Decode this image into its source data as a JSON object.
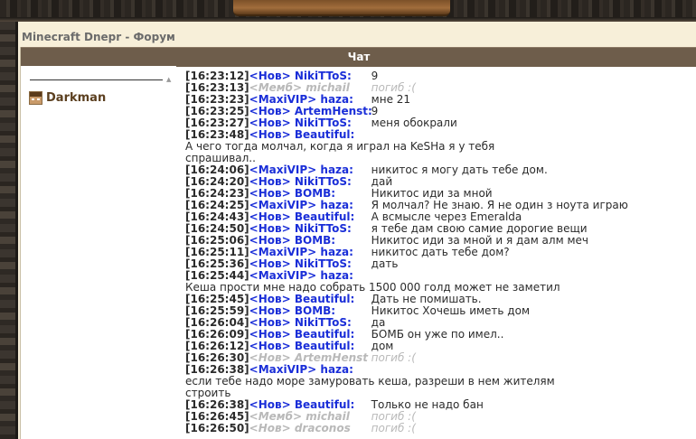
{
  "forum_title": "Minecraft Dnepr - Форум",
  "chat": {
    "header": "Чат",
    "users": [
      {
        "name": "Darkman"
      }
    ],
    "messages": [
      {
        "time": "[16:23:12]",
        "user": "<Нов> NikiTToS:",
        "text": "9",
        "type": "normal"
      },
      {
        "time": "[16:23:13]",
        "user": "<Мемб> michail",
        "text": "погиб :(",
        "type": "sys"
      },
      {
        "time": "[16:23:23]",
        "user": "<MaxiVIP> haza:",
        "text": "мне 21",
        "type": "normal"
      },
      {
        "time": "[16:23:25]",
        "user": "<Нов> ArtemHenst:",
        "text": "9",
        "type": "normal"
      },
      {
        "time": "[16:23:27]",
        "user": "<Нов> NikiTToS:",
        "text": "меня обокрали",
        "type": "normal"
      },
      {
        "time": "[16:23:48]",
        "user": "<Нов> Beautiful:",
        "text": "",
        "type": "normal"
      },
      {
        "time": "",
        "user": "",
        "text": "А чего тогда молчал, когда я играл на KeSHa я у тебя",
        "type": "cont"
      },
      {
        "time": "",
        "user": "",
        "text": "спрашивал..",
        "type": "cont"
      },
      {
        "time": "[16:24:06]",
        "user": "<MaxiVIP> haza:",
        "text": "никитос я могу дать тебе дом.",
        "type": "normal"
      },
      {
        "time": "[16:24:20]",
        "user": "<Нов> NikiTToS:",
        "text": "дай",
        "type": "normal"
      },
      {
        "time": "[16:24:23]",
        "user": "<Нов> BOMB:",
        "text": "Никитос иди за мной",
        "type": "normal"
      },
      {
        "time": "[16:24:25]",
        "user": "<MaxiVIP> haza:",
        "text": "Я молчал? Не знаю. Я не один з ноута играю",
        "type": "normal"
      },
      {
        "time": "[16:24:43]",
        "user": "<Нов> Beautiful:",
        "text": "А всмысле через Emeralda",
        "type": "normal"
      },
      {
        "time": "[16:24:50]",
        "user": "<Нов> NikiTToS:",
        "text": "я тебе дам свою самие дорогие вещи",
        "type": "normal"
      },
      {
        "time": "[16:25:06]",
        "user": "<Нов> BOMB:",
        "text": "Никитос иди за мной и я дам алм меч",
        "type": "normal"
      },
      {
        "time": "[16:25:11]",
        "user": "<MaxiVIP> haza:",
        "text": "никитос дать тебе дом?",
        "type": "normal"
      },
      {
        "time": "[16:25:36]",
        "user": "<Нов> NikiTToS:",
        "text": "дать",
        "type": "normal"
      },
      {
        "time": "[16:25:44]",
        "user": "<MaxiVIP> haza:",
        "text": "",
        "type": "normal"
      },
      {
        "time": "",
        "user": "",
        "text": "Кеша прости мне надо собрать 1500 000 голд может не заметил",
        "type": "cont"
      },
      {
        "time": "[16:25:45]",
        "user": "<Нов> Beautiful:",
        "text": "Дать не помишать.",
        "type": "normal"
      },
      {
        "time": "[16:25:59]",
        "user": "<Нов> BOMB:",
        "text": "Никитос Хочешь иметь дом",
        "type": "normal"
      },
      {
        "time": "[16:26:04]",
        "user": "<Нов> NikiTToS:",
        "text": "да",
        "type": "normal"
      },
      {
        "time": "[16:26:09]",
        "user": "<Нов> Beautiful:",
        "text": "БОМБ он уже по имел..",
        "type": "normal"
      },
      {
        "time": "[16:26:12]",
        "user": "<Нов> Beautiful:",
        "text": "дом",
        "type": "normal"
      },
      {
        "time": "[16:26:30]",
        "user": "<Нов> ArtemHenst",
        "text": "погиб :(",
        "type": "sys"
      },
      {
        "time": "[16:26:38]",
        "user": "<MaxiVIP> haza:",
        "text": "",
        "type": "normal"
      },
      {
        "time": "",
        "user": "",
        "text": "если тебе надо море замуровать кеша, разреши в нем жителям",
        "type": "cont"
      },
      {
        "time": "",
        "user": "",
        "text": "строить",
        "type": "cont"
      },
      {
        "time": "[16:26:38]",
        "user": "<Нов> Beautiful:",
        "text": "Только не надо бан",
        "type": "normal"
      },
      {
        "time": "[16:26:45]",
        "user": "<Мемб> michail",
        "text": "погиб :(",
        "type": "sys"
      },
      {
        "time": "[16:26:50]",
        "user": "<Нов> draconos",
        "text": "погиб :(",
        "type": "sys"
      }
    ]
  }
}
